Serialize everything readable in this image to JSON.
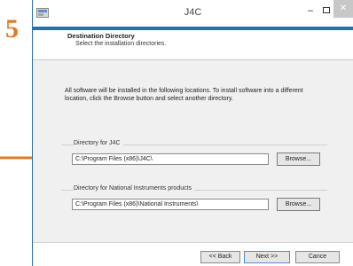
{
  "step": {
    "number": "5",
    "color": "#e07a26"
  },
  "window": {
    "title": "J4C",
    "accent_color": "#2b6cb3",
    "app_icon": "installer-icon"
  },
  "header": {
    "title": "Destination Directory",
    "subtitle": "Select the installation directories."
  },
  "description": "All software will be installed in the following locations. To install software into a different location, click the Browse button and select another directory.",
  "directories": [
    {
      "label": "Directory for J4C",
      "path": "C:\\Program Files (x86)\\J4C\\",
      "browse_label": "Browse..."
    },
    {
      "label": "Directory for National Instruments products",
      "path": "C:\\Program Files (x86)\\National Instruments\\",
      "browse_label": "Browse..."
    }
  ],
  "footer": {
    "back_label": "<< Back",
    "next_label": "Next >>",
    "cancel_label": "Cance"
  }
}
